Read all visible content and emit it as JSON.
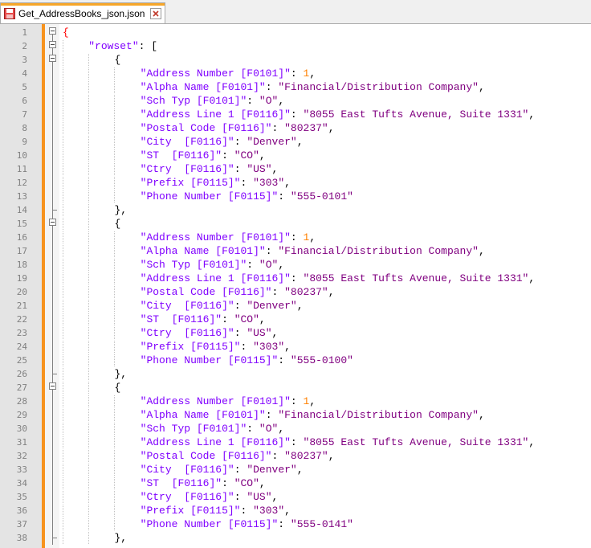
{
  "tab": {
    "title": "Get_AddressBooks_json.json",
    "icon": "file-save-icon",
    "close_icon": "close-icon"
  },
  "editor": {
    "line_numbers": [
      "1",
      "2",
      "3",
      "4",
      "5",
      "6",
      "7",
      "8",
      "9",
      "10",
      "11",
      "12",
      "13",
      "14",
      "15",
      "16",
      "17",
      "18",
      "19",
      "20",
      "21",
      "22",
      "23",
      "24",
      "25",
      "26",
      "27",
      "28",
      "29",
      "30",
      "31",
      "32",
      "33",
      "34",
      "35",
      "36",
      "37",
      "38"
    ],
    "lines": [
      "{",
      "    \"rowset\": [",
      "        {",
      "            \"Address Number [F0101]\": 1,",
      "            \"Alpha Name [F0101]\": \"Financial/Distribution Company\",",
      "            \"Sch Typ [F0101]\": \"O\",",
      "            \"Address Line 1 [F0116]\": \"8055 East Tufts Avenue, Suite 1331\",",
      "            \"Postal Code [F0116]\": \"80237\",",
      "            \"City  [F0116]\": \"Denver\",",
      "            \"ST  [F0116]\": \"CO\",",
      "            \"Ctry  [F0116]\": \"US\",",
      "            \"Prefix [F0115]\": \"303\",",
      "            \"Phone Number [F0115]\": \"555-0101\"",
      "        },",
      "        {",
      "            \"Address Number [F0101]\": 1,",
      "            \"Alpha Name [F0101]\": \"Financial/Distribution Company\",",
      "            \"Sch Typ [F0101]\": \"O\",",
      "            \"Address Line 1 [F0116]\": \"8055 East Tufts Avenue, Suite 1331\",",
      "            \"Postal Code [F0116]\": \"80237\",",
      "            \"City  [F0116]\": \"Denver\",",
      "            \"ST  [F0116]\": \"CO\",",
      "            \"Ctry  [F0116]\": \"US\",",
      "            \"Prefix [F0115]\": \"303\",",
      "            \"Phone Number [F0115]\": \"555-0100\"",
      "        },",
      "        {",
      "            \"Address Number [F0101]\": 1,",
      "            \"Alpha Name [F0101]\": \"Financial/Distribution Company\",",
      "            \"Sch Typ [F0101]\": \"O\",",
      "            \"Address Line 1 [F0116]\": \"8055 East Tufts Avenue, Suite 1331\",",
      "            \"Postal Code [F0116]\": \"80237\",",
      "            \"City  [F0116]\": \"Denver\",",
      "            \"ST  [F0116]\": \"CO\",",
      "            \"Ctry  [F0116]\": \"US\",",
      "            \"Prefix [F0115]\": \"303\",",
      "            \"Phone Number [F0115]\": \"555-0141\"",
      "        },"
    ],
    "fold_markers": [
      "open",
      "open",
      "open",
      "none",
      "none",
      "none",
      "none",
      "none",
      "none",
      "none",
      "none",
      "none",
      "none",
      "end",
      "open",
      "none",
      "none",
      "none",
      "none",
      "none",
      "none",
      "none",
      "none",
      "none",
      "none",
      "end",
      "open",
      "none",
      "none",
      "none",
      "none",
      "none",
      "none",
      "none",
      "none",
      "none",
      "none",
      "end"
    ],
    "colors": {
      "key": "#8000ff",
      "string": "#800080",
      "number": "#ff8000",
      "punct": "#000000",
      "brace_highlight": "#ff0000",
      "change_bar": "#f7931e"
    }
  }
}
